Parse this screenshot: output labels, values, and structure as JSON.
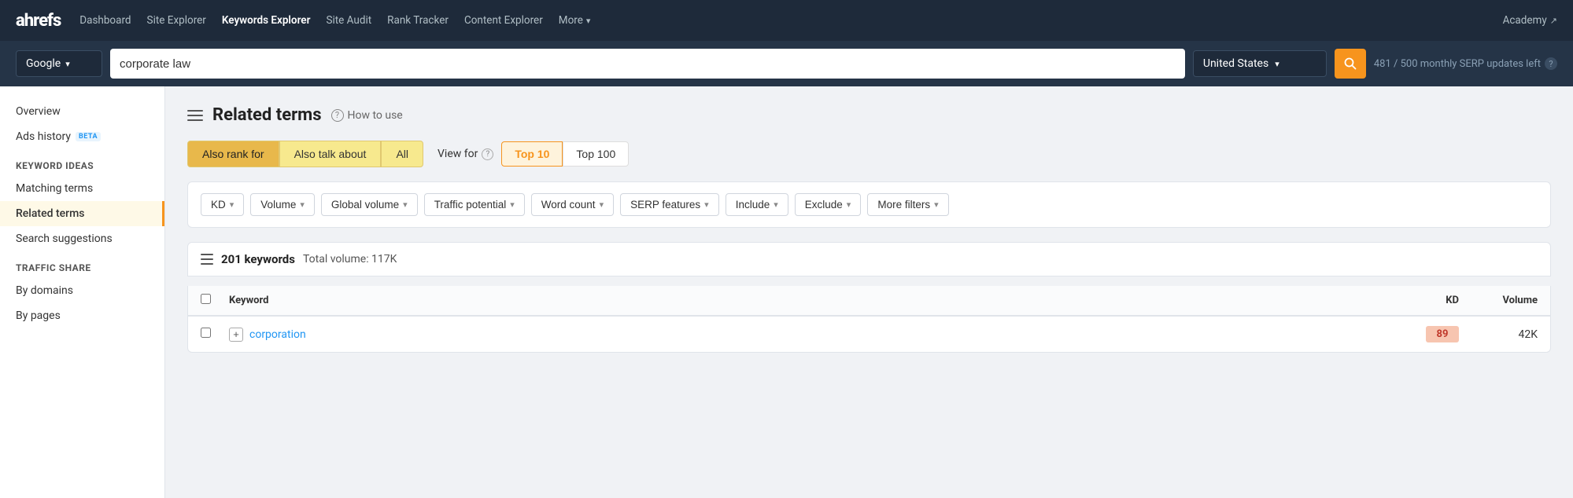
{
  "logo": {
    "brand": "ahrefs",
    "highlight": "a"
  },
  "nav": {
    "links": [
      {
        "label": "Dashboard",
        "active": false
      },
      {
        "label": "Site Explorer",
        "active": false
      },
      {
        "label": "Keywords Explorer",
        "active": true
      },
      {
        "label": "Site Audit",
        "active": false
      },
      {
        "label": "Rank Tracker",
        "active": false
      },
      {
        "label": "Content Explorer",
        "active": false
      }
    ],
    "more_label": "More",
    "academy_label": "Academy"
  },
  "search_bar": {
    "engine_label": "Google",
    "query": "corporate law",
    "country": "United States",
    "serp_updates": "481 / 500 monthly SERP updates left"
  },
  "sidebar": {
    "overview_label": "Overview",
    "ads_history_label": "Ads history",
    "ads_history_badge": "BETA",
    "keyword_ideas_section": "Keyword ideas",
    "matching_terms_label": "Matching terms",
    "related_terms_label": "Related terms",
    "search_suggestions_label": "Search suggestions",
    "traffic_share_section": "Traffic share",
    "by_domains_label": "By domains",
    "by_pages_label": "By pages"
  },
  "main": {
    "page_title": "Related terms",
    "how_to_use_label": "How to use",
    "tabs": [
      {
        "label": "Also rank for",
        "active": true
      },
      {
        "label": "Also talk about",
        "active": false
      },
      {
        "label": "All",
        "active": false
      }
    ],
    "view_for_label": "View for",
    "view_btns": [
      {
        "label": "Top 10",
        "active": true
      },
      {
        "label": "Top 100",
        "active": false
      }
    ],
    "filters": [
      {
        "label": "KD"
      },
      {
        "label": "Volume"
      },
      {
        "label": "Global volume"
      },
      {
        "label": "Traffic potential"
      },
      {
        "label": "Word count"
      },
      {
        "label": "SERP features"
      },
      {
        "label": "Include"
      },
      {
        "label": "Exclude"
      },
      {
        "label": "More filters"
      }
    ],
    "results_count": "201 keywords",
    "results_volume": "Total volume: 117K",
    "table_headers": {
      "keyword": "Keyword",
      "kd": "KD",
      "volume": "Volume"
    },
    "table_rows": [
      {
        "keyword": "corporation",
        "kd": "89",
        "volume": "42K"
      }
    ]
  }
}
